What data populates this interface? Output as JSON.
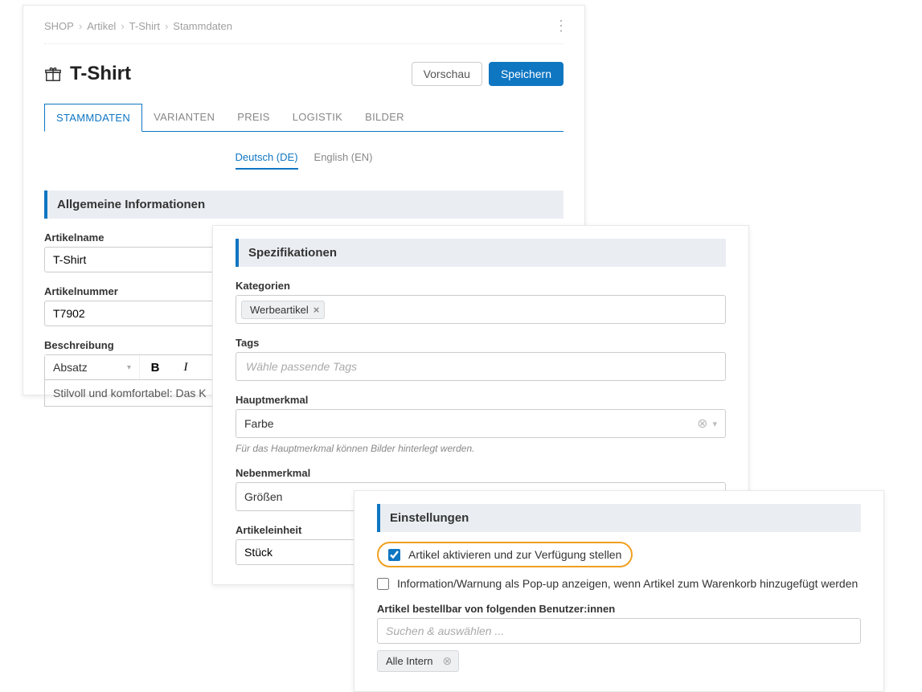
{
  "breadcrumb": {
    "b0": "SHOP",
    "b1": "Artikel",
    "b2": "T-Shirt",
    "b3": "Stammdaten"
  },
  "header": {
    "title": "T-Shirt",
    "preview_label": "Vorschau",
    "save_label": "Speichern"
  },
  "tabs": {
    "t0": "STAMMDATEN",
    "t1": "VARIANTEN",
    "t2": "PREIS",
    "t3": "LOGISTIK",
    "t4": "BILDER"
  },
  "lang": {
    "de": "Deutsch (DE)",
    "en": "English (EN)"
  },
  "section1": {
    "title": "Allgemeine Informationen",
    "artikelname_label": "Artikelname",
    "artikelname_value": "T-Shirt",
    "artikelnummer_label": "Artikelnummer",
    "artikelnummer_value": "T7902",
    "beschreibung_label": "Beschreibung",
    "para_select": "Absatz",
    "desc_preview": "Stilvoll und komfortabel: Das K"
  },
  "spez": {
    "title": "Spezifikationen",
    "kategorien_label": "Kategorien",
    "kategorien_chip": "Werbeartikel",
    "tags_label": "Tags",
    "tags_placeholder": "Wähle passende Tags",
    "haupt_label": "Hauptmerkmal",
    "haupt_value": "Farbe",
    "haupt_hint": "Für das Hauptmerkmal können Bilder hinterlegt werden.",
    "neben_label": "Nebenmerkmal",
    "neben_value": "Größen",
    "einheit_label": "Artikeleinheit",
    "einheit_value": "Stück"
  },
  "einst": {
    "title": "Einstellungen",
    "cb1_label": "Artikel aktivieren und zur Verfügung stellen",
    "cb2_label": "Information/Warnung als Pop-up anzeigen, wenn Artikel zum Warenkorb hinzugefügt werden",
    "order_label": "Artikel bestellbar von folgenden Benutzer:innen",
    "order_placeholder": "Suchen & auswählen ...",
    "chip": "Alle Intern"
  }
}
